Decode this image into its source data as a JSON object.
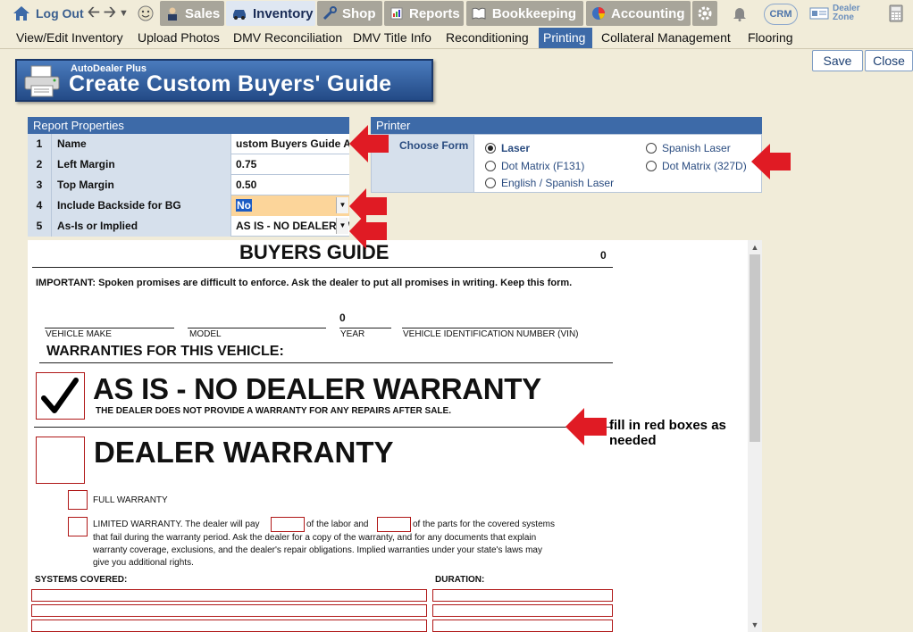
{
  "topbar": {
    "logout": "Log Out",
    "tabs": [
      {
        "label": "Sales"
      },
      {
        "label": "Inventory"
      },
      {
        "label": "Shop"
      },
      {
        "label": "Reports"
      },
      {
        "label": "Bookkeeping"
      },
      {
        "label": "Accounting"
      }
    ],
    "crm": "CRM",
    "dealer_zone_1": "Dealer",
    "dealer_zone_2": "Zone"
  },
  "subnav": {
    "items": [
      "View/Edit Inventory",
      "Upload Photos",
      "DMV Reconciliation",
      "DMV Title Info",
      "Reconditioning",
      "Printing",
      "Collateral Management",
      "Flooring"
    ],
    "active": "Printing"
  },
  "buttons": {
    "save": "Save",
    "close": "Close"
  },
  "banner": {
    "subtitle": "AutoDealer Plus",
    "title": "Create Custom Buyers' Guide"
  },
  "report_properties": {
    "heading": "Report Properties",
    "rows": [
      {
        "num": "1",
        "label": "Name",
        "value": "ustom Buyers Guide As-Is"
      },
      {
        "num": "2",
        "label": "Left Margin",
        "value": "0.75"
      },
      {
        "num": "3",
        "label": "Top Margin",
        "value": "0.50"
      },
      {
        "num": "4",
        "label": "Include Backside for BG",
        "value": "No"
      },
      {
        "num": "5",
        "label": "As-Is or Implied",
        "value": "AS IS - NO DEALER W"
      }
    ]
  },
  "printer": {
    "heading": "Printer",
    "choose_form": "Choose Form",
    "options": [
      "Laser",
      "Dot Matrix (F131)",
      "English / Spanish Laser",
      "Spanish Laser",
      "Dot Matrix (327D)"
    ],
    "selected": "Laser"
  },
  "document": {
    "title": "BUYERS GUIDE",
    "corner_number": "0",
    "important": "IMPORTANT: Spoken promises are difficult to enforce.  Ask the dealer to put all promises in writing.  Keep this form.",
    "year_value": "0",
    "fields": {
      "make": "VEHICLE MAKE",
      "model": "MODEL",
      "year": "YEAR",
      "vin": "VEHICLE IDENTIFICATION NUMBER (VIN)"
    },
    "warranties_heading": "WARRANTIES FOR THIS VEHICLE:",
    "as_is_title": "AS IS - NO DEALER WARRANTY",
    "as_is_sub": "THE DEALER DOES NOT PROVIDE A WARRANTY FOR ANY REPAIRS AFTER SALE.",
    "dealer_warranty": "DEALER WARRANTY",
    "full_warranty": "FULL WARRANTY",
    "limited_1": "LIMITED WARRANTY. The dealer will pay",
    "limited_2": "of the labor and",
    "limited_3": "of the parts for the covered systems",
    "limited_4": "that fail during the warranty period.  Ask the dealer for a copy of the warranty, and for any documents that explain",
    "limited_5": "warranty coverage, exclusions, and the dealer's repair obligations. Implied warranties under your state's laws may",
    "limited_6": "give you additional rights.",
    "systems_covered": "SYSTEMS COVERED:",
    "duration": "DURATION:",
    "annotation": "fill in red boxes as needed"
  }
}
